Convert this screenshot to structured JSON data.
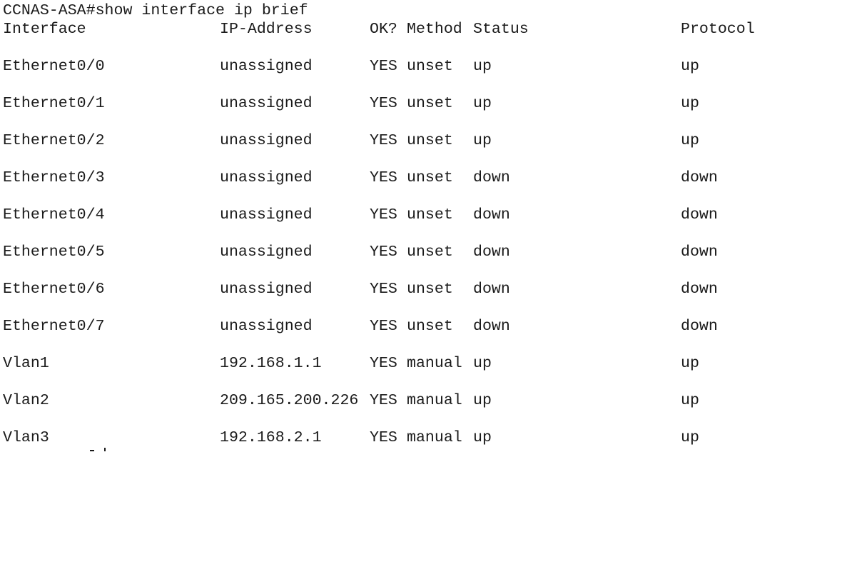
{
  "terminal": {
    "command": "CCNAS-ASA#show interface ip brief",
    "headers": {
      "interface": "Interface",
      "ip": "IP-Address",
      "ok": "OK?",
      "method": "Method",
      "status": "Status",
      "protocol": "Protocol"
    },
    "rows": [
      {
        "interface": "Ethernet0/0",
        "ip": "unassigned",
        "ok": "YES",
        "method": "unset",
        "status": "up",
        "protocol": "up"
      },
      {
        "interface": "Ethernet0/1",
        "ip": "unassigned",
        "ok": "YES",
        "method": "unset",
        "status": "up",
        "protocol": "up"
      },
      {
        "interface": "Ethernet0/2",
        "ip": "unassigned",
        "ok": "YES",
        "method": "unset",
        "status": "up",
        "protocol": "up"
      },
      {
        "interface": "Ethernet0/3",
        "ip": "unassigned",
        "ok": "YES",
        "method": "unset",
        "status": "down",
        "protocol": "down"
      },
      {
        "interface": "Ethernet0/4",
        "ip": "unassigned",
        "ok": "YES",
        "method": "unset",
        "status": "down",
        "protocol": "down"
      },
      {
        "interface": "Ethernet0/5",
        "ip": "unassigned",
        "ok": "YES",
        "method": "unset",
        "status": "down",
        "protocol": "down"
      },
      {
        "interface": "Ethernet0/6",
        "ip": "unassigned",
        "ok": "YES",
        "method": "unset",
        "status": "down",
        "protocol": "down"
      },
      {
        "interface": "Ethernet0/7",
        "ip": "unassigned",
        "ok": "YES",
        "method": "unset",
        "status": "down",
        "protocol": "down"
      },
      {
        "interface": "Vlan1",
        "ip": "192.168.1.1",
        "ok": "YES",
        "method": "manual",
        "status": "up",
        "protocol": "up"
      },
      {
        "interface": "Vlan2",
        "ip": "209.165.200.226",
        "ok": "YES",
        "method": "manual",
        "status": "up",
        "protocol": "up"
      },
      {
        "interface": "Vlan3",
        "ip": "192.168.2.1",
        "ok": "YES",
        "method": "manual",
        "status": "up",
        "protocol": "up"
      }
    ]
  }
}
